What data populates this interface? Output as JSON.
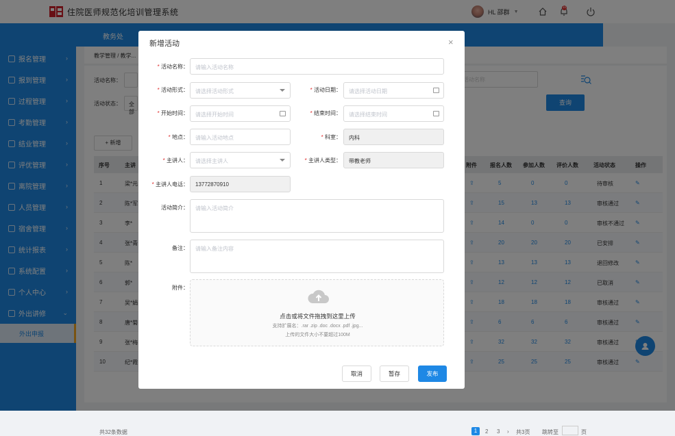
{
  "app": {
    "title": "住院医师规范化培训管理系统"
  },
  "user": {
    "name": "HL 邵群"
  },
  "header": {
    "tab": "教务处"
  },
  "sidebar": {
    "items": [
      {
        "label": "报名管理"
      },
      {
        "label": "报到管理"
      },
      {
        "label": "过程管理"
      },
      {
        "label": "考勤管理"
      },
      {
        "label": "结业管理"
      },
      {
        "label": "评优管理"
      },
      {
        "label": "离院管理"
      },
      {
        "label": "人员管理"
      },
      {
        "label": "宿舍管理"
      },
      {
        "label": "统计报表"
      },
      {
        "label": "系统配置"
      },
      {
        "label": "个人中心"
      },
      {
        "label": "外出讲修"
      }
    ],
    "sub_item": "外出申报"
  },
  "breadcrumb": "教学管理 / 教学...",
  "filter": {
    "name_label": "活动名称：",
    "status_label": "活动状态：",
    "status_value": "全部",
    "name_placeholder_right": "活动名称",
    "search_label": "查询"
  },
  "table": {
    "add_label": "新增",
    "headers": [
      "序号",
      "主讲",
      "附件",
      "报名人数",
      "参加人数",
      "评价人数",
      "活动状态",
      "操作"
    ],
    "rows": [
      {
        "no": "1",
        "name": "梁*元",
        "signup": "5",
        "attend": "0",
        "rate": "0",
        "status": "待审核",
        "ops": "编辑"
      },
      {
        "no": "2",
        "name": "陈*军",
        "signup": "15",
        "attend": "13",
        "rate": "13",
        "status": "审核通过",
        "ops": ""
      },
      {
        "no": "3",
        "name": "李*",
        "signup": "14",
        "attend": "0",
        "rate": "0",
        "status": "审核不通过",
        "ops": ""
      },
      {
        "no": "4",
        "name": "张*青",
        "signup": "20",
        "attend": "20",
        "rate": "20",
        "status": "已安排",
        "ops": ""
      },
      {
        "no": "5",
        "name": "陈*",
        "signup": "13",
        "attend": "13",
        "rate": "13",
        "status": "退回修改",
        "ops": ""
      },
      {
        "no": "6",
        "name": "郭*",
        "signup": "12",
        "attend": "12",
        "rate": "12",
        "status": "已取消",
        "ops": ""
      },
      {
        "no": "7",
        "name": "吴*娟",
        "signup": "18",
        "attend": "18",
        "rate": "18",
        "status": "审核通过",
        "ops": ""
      },
      {
        "no": "8",
        "name": "唐*菊",
        "signup": "6",
        "attend": "6",
        "rate": "6",
        "status": "审核通过",
        "ops": ""
      },
      {
        "no": "9",
        "name": "张*梅",
        "signup": "32",
        "attend": "32",
        "rate": "32",
        "status": "审核通过",
        "ops": ""
      },
      {
        "no": "10",
        "name": "纪*霞",
        "signup": "25",
        "attend": "25",
        "rate": "25",
        "status": "审核通过",
        "ops": ""
      }
    ],
    "total": "共32条数据",
    "pages": [
      "1",
      "2",
      "3"
    ],
    "page_count": "共3页",
    "goto": "跳转至",
    "page_unit": "页"
  },
  "modal": {
    "title": "新增活动",
    "fields": {
      "name_label": "活动名称：",
      "name_ph": "请输入活动名称",
      "form_label": "活动形式：",
      "form_ph": "请选择活动形式",
      "date_label": "活动日期：",
      "date_ph": "请选择活动日期",
      "start_label": "开始时间：",
      "start_ph": "请选择开始时间",
      "end_label": "结束时间：",
      "end_ph": "请选择结束时间",
      "place_label": "地点：",
      "place_ph": "请输入活动地点",
      "dept_label": "科室：",
      "dept_value": "内科",
      "speaker_label": "主讲人：",
      "speaker_ph": "请选择主讲人",
      "speaker_type_label": "主讲人类型：",
      "speaker_type_value": "带教老师",
      "phone_label": "主讲人电话：",
      "phone_value": "13772870910",
      "intro_label": "活动简介：",
      "intro_ph": "请输入活动简介",
      "remark_label": "备注：",
      "remark_ph": "请输入备注内容",
      "attach_label": "附件："
    },
    "upload": {
      "main": "点击或将文件拖拽到这里上传",
      "ext": "支持扩展名：.rar .zip .doc .docx .pdf .jpg...",
      "size": "上传的文件大小不要超过100M"
    },
    "buttons": {
      "cancel": "取消",
      "draft": "暂存",
      "publish": "发布"
    }
  },
  "colors": {
    "primary": "#1e88e5",
    "danger": "#e03030"
  }
}
